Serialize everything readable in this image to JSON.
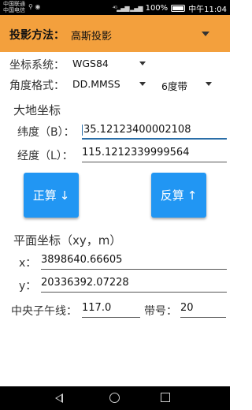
{
  "status_bar": {
    "carrier_1": "中国联通",
    "carrier_2": "中国电信",
    "battery": "100%",
    "time": "中午11:04"
  },
  "toolbar": {
    "projection_label": "投影方法：",
    "projection_value": "高斯投影"
  },
  "settings": {
    "coord_system_label": "坐标系统：",
    "coord_system_value": "WGS84",
    "angle_format_label": "角度格式：",
    "angle_format_value": "DD.MMSS",
    "zone_type_value": "6度带"
  },
  "geodetic": {
    "title": "大地坐标",
    "lat_label": "纬度（B）：",
    "lat_value": "35.12123400002108",
    "lon_label": "经度（L）：",
    "lon_value": "115.1212339999564"
  },
  "buttons": {
    "forward_label": "正算",
    "forward_arrow": "↓",
    "inverse_label": "反算",
    "inverse_arrow": "↑"
  },
  "plane": {
    "title": "平面坐标（xy，m）",
    "x_label": "x：",
    "x_value": "3898640.66605",
    "y_label": "y：",
    "y_value": "20336392.07228",
    "central_meridian_label": "中央子午线：",
    "central_meridian_value": "117.0",
    "zone_number_label": "带号：",
    "zone_number_value": "20"
  }
}
